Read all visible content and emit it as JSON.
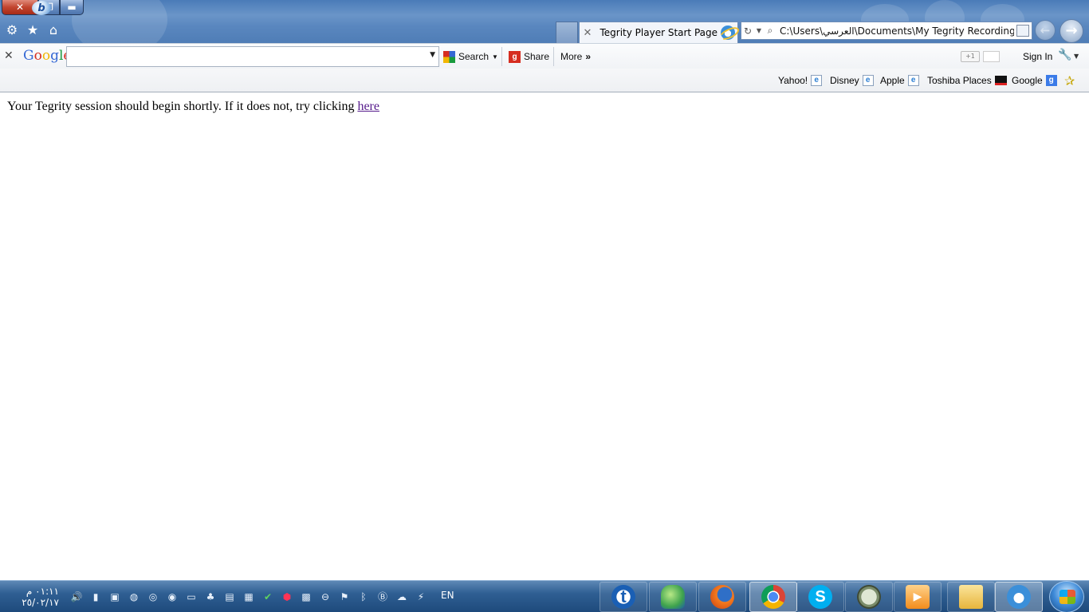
{
  "browser": {
    "tab": {
      "title": "Tegrity Player Start Page"
    },
    "address": "C:\\Users\\العرسي\\Documents\\My Tegrity Recordings\\S"
  },
  "google_toolbar": {
    "logo": [
      "G",
      "o",
      "o",
      "g",
      "l",
      "e"
    ],
    "search_placeholder": "",
    "search_label": "Search",
    "share_label": "Share",
    "more_label": "More",
    "plus_one": "+1",
    "sign_in_label": "Sign In"
  },
  "favorites": [
    {
      "label": "Yahoo!",
      "icon": "ie-page-icon"
    },
    {
      "label": "Disney",
      "icon": "ie-page-icon"
    },
    {
      "label": "Apple",
      "icon": "ie-page-icon"
    },
    {
      "label": "Toshiba Places",
      "icon": "toshiba-icon"
    },
    {
      "label": "Google",
      "icon": "google-icon"
    }
  ],
  "content": {
    "message": "Your Tegrity session should begin shortly. If it does not, try clicking ",
    "link": "here"
  },
  "taskbar": {
    "time": "٠١:١١ م",
    "date": "٢٥/٠٢/١٧",
    "language": "EN",
    "apps": [
      "tegrity",
      "messenger",
      "firefox",
      "chrome",
      "skype",
      "app",
      "media-player",
      "explorer",
      "internet-explorer"
    ]
  }
}
